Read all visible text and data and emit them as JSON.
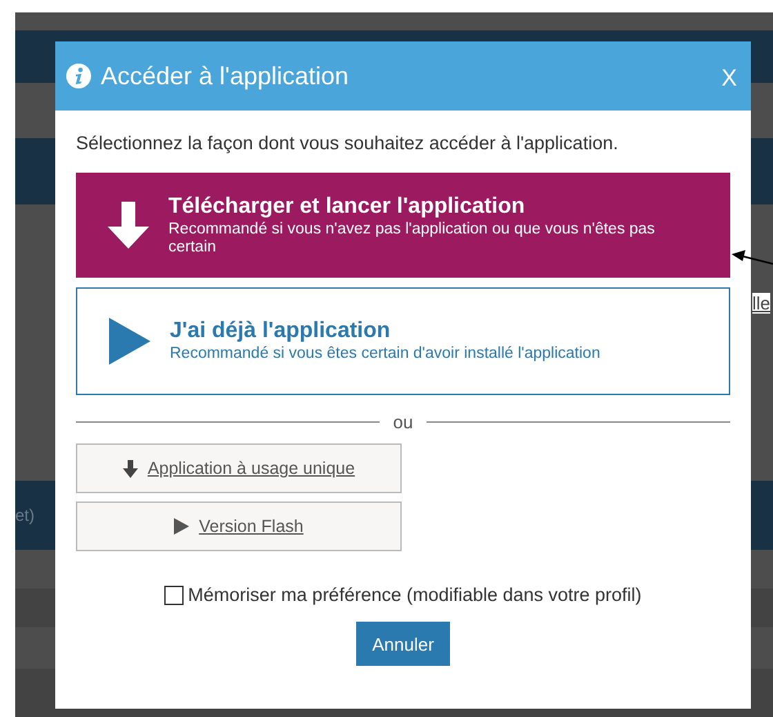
{
  "background_page": {
    "link_fragment": "lle",
    "text_fragment": "et)"
  },
  "dialog": {
    "title": "Accéder à l'application",
    "close": "X",
    "intro": "Sélectionnez la façon dont vous souhaitez accéder à l'application.",
    "options": [
      {
        "kind": "download",
        "title": "Télécharger et lancer l'application",
        "subtitle": "Recommandé si vous n'avez pas l'application ou que vous n'êtes pas certain",
        "selected": true
      },
      {
        "kind": "play",
        "title": "J'ai déjà l'application",
        "subtitle": "Recommandé si vous êtes certain d'avoir installé l'application",
        "selected": false
      }
    ],
    "divider_label": "ou",
    "alt_links": [
      {
        "kind": "download",
        "label": "Application à usage unique"
      },
      {
        "kind": "play",
        "label": "Version Flash"
      }
    ],
    "remember": {
      "label": "Mémoriser ma préférence (modifiable dans votre profil)",
      "checked": false
    },
    "cancel": "Annuler"
  }
}
